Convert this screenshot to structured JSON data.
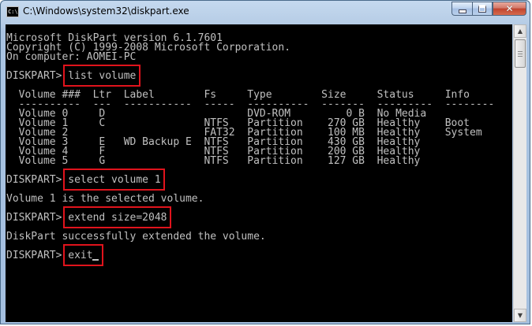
{
  "window": {
    "title": "C:\\Windows\\system32\\diskpart.exe",
    "icon_text": "C:\\"
  },
  "caption_buttons": {
    "minimize": "minimize-icon",
    "maximize": "maximize-icon",
    "close": "close-icon"
  },
  "console": {
    "banner": [
      "Microsoft DiskPart version 6.1.7601",
      "Copyright (C) 1999-2008 Microsoft Corporation.",
      "On computer: AOMEI-PC"
    ],
    "prompt": "DISKPART>",
    "commands": [
      "list volume",
      "select volume 1",
      "extend size=2048",
      "exit"
    ],
    "volume_table": {
      "headers": [
        "Volume ###",
        "Ltr",
        "Label",
        "Fs",
        "Type",
        "Size",
        "Status",
        "Info"
      ],
      "rows": [
        [
          "Volume 0",
          "D",
          "",
          "",
          "DVD-ROM",
          "0 B",
          "No Media",
          ""
        ],
        [
          "Volume 1",
          "C",
          "",
          "NTFS",
          "Partition",
          "270 GB",
          "Healthy",
          "Boot"
        ],
        [
          "Volume 2",
          "",
          "",
          "FAT32",
          "Partition",
          "100 MB",
          "Healthy",
          "System"
        ],
        [
          "Volume 3",
          "E",
          "WD Backup E",
          "NTFS",
          "Partition",
          "430 GB",
          "Healthy",
          ""
        ],
        [
          "Volume 4",
          "F",
          "",
          "NTFS",
          "Partition",
          "200 GB",
          "Healthy",
          ""
        ],
        [
          "Volume 5",
          "G",
          "",
          "NTFS",
          "Partition",
          "127 GB",
          "Healthy",
          ""
        ]
      ]
    },
    "messages": [
      "Volume 1 is the selected volume.",
      "DiskPart successfully extended the volume."
    ],
    "highlight_color": "#e0131c",
    "text_color": "#c0c0c0",
    "background_color": "#000000"
  }
}
